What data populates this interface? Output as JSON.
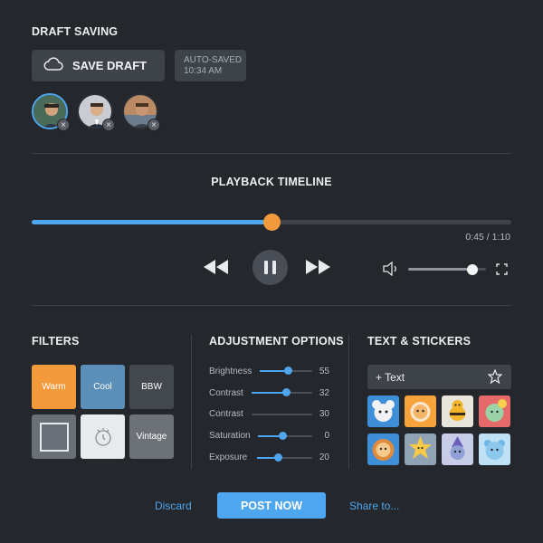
{
  "draft": {
    "heading": "DRAFT SAVING",
    "save_label": "SAVE DRAFT",
    "autosave_status": "AUTO-SAVED",
    "autosave_time": "10:34 AM",
    "collaborators": [
      {
        "icon": "person-avatar",
        "remove": "×"
      },
      {
        "icon": "person-avatar",
        "remove": "×"
      },
      {
        "icon": "person-avatar",
        "remove": "×"
      }
    ]
  },
  "playback": {
    "heading": "PLAYBACK TIMELINE",
    "time_display": "0:45 / 1:10",
    "progress": 0.5,
    "volume": 0.82
  },
  "filters": {
    "heading": "FILTERS",
    "tiles": [
      {
        "label": "Warm",
        "color": "#f39a3c"
      },
      {
        "label": "Cool",
        "color": "#5b8fb8"
      },
      {
        "label": "BBW",
        "color": "#43474e"
      },
      {
        "label": "",
        "color": "#6a7078"
      },
      {
        "label": "",
        "color": "#e9eaeb"
      },
      {
        "label": "Vintage",
        "color": "#6d7279"
      }
    ]
  },
  "adjustment": {
    "heading": "ADJUSTMENT OPTIONS",
    "rows": [
      {
        "label": "Brightness",
        "value": "55",
        "level": 0.55
      },
      {
        "label": "Contrast",
        "value": "32",
        "level": 0.58
      },
      {
        "label": "Contrast",
        "value": "30",
        "level": 0.0
      },
      {
        "label": "Saturation",
        "value": "0",
        "level": 0.45
      },
      {
        "label": "Exposure",
        "value": "20",
        "level": 0.38
      }
    ]
  },
  "text_stickers": {
    "heading": "TEXT & STICKERS",
    "add_text_label": "+ Text",
    "stickers": [
      "mouse",
      "orange-cat",
      "bee",
      "flower-cat",
      "lion",
      "sun-cat",
      "wizard",
      "blue-bear"
    ]
  },
  "footer": {
    "discard_label": "Discard",
    "post_label": "POST NOW",
    "share_label": "Share to..."
  },
  "colors": {
    "accent": "#4ea6ee",
    "knob": "#f39a3c",
    "background": "#24272c"
  }
}
